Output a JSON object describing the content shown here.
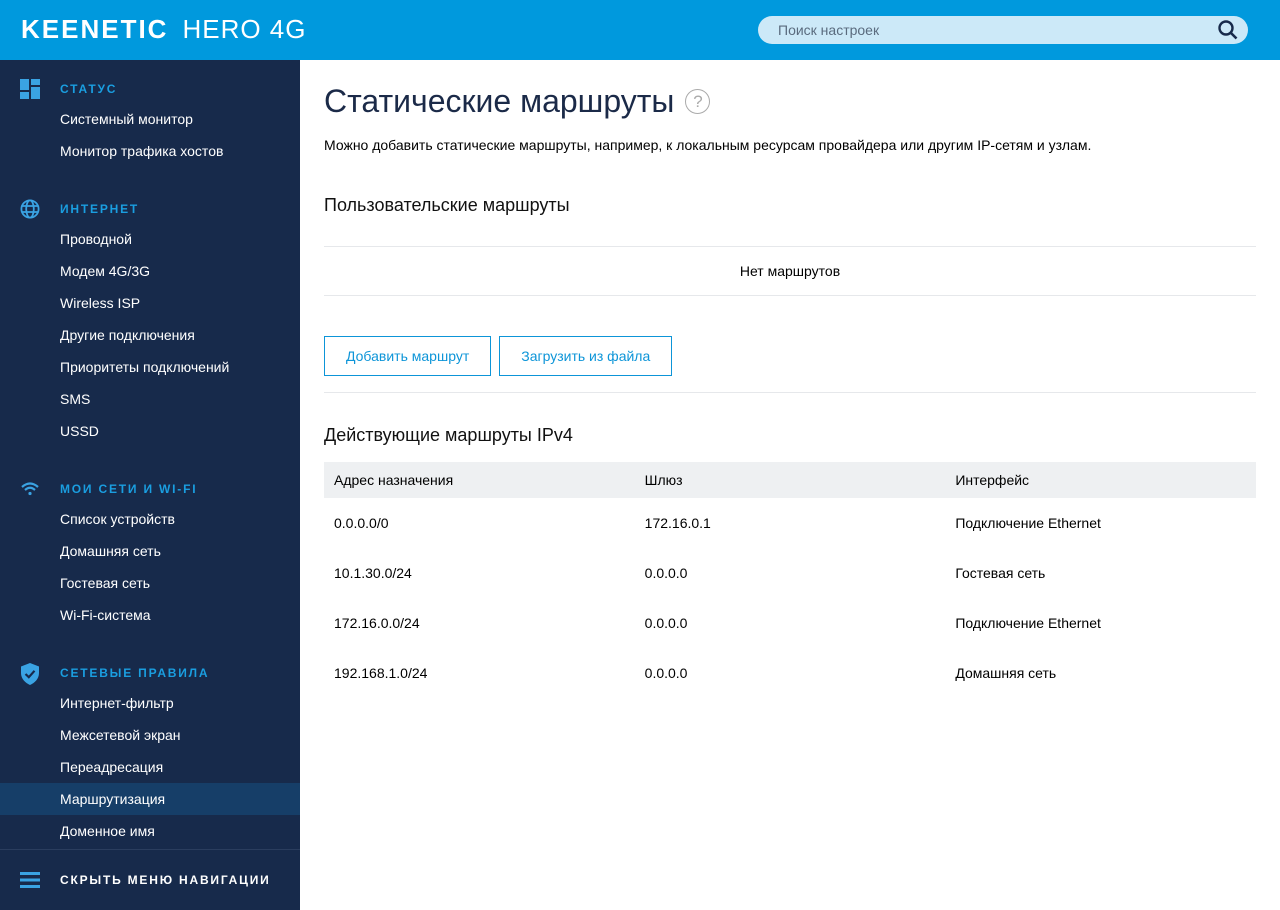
{
  "header": {
    "brand": "KEENETIC",
    "model": "HERO 4G",
    "search_placeholder": "Поиск настроек"
  },
  "colors": {
    "header": "#0099dd",
    "sidebar": "#172a4b",
    "accent": "#1a9ee0",
    "active": "#163e68"
  },
  "sidebar": {
    "sections": [
      {
        "title": "СТАТУС",
        "icon": "dashboard-icon",
        "items": [
          "Системный монитор",
          "Монитор трафика хостов"
        ]
      },
      {
        "title": "ИНТЕРНЕТ",
        "icon": "globe-icon",
        "items": [
          "Проводной",
          "Модем 4G/3G",
          "Wireless ISP",
          "Другие подключения",
          "Приоритеты подключений",
          "SMS",
          "USSD"
        ]
      },
      {
        "title": "МОИ СЕТИ И WI-FI",
        "icon": "wifi-icon",
        "items": [
          "Список устройств",
          "Домашняя сеть",
          "Гостевая сеть",
          "Wi-Fi-система"
        ]
      },
      {
        "title": "СЕТЕВЫЕ ПРАВИЛА",
        "icon": "shield-icon",
        "items": [
          "Интернет-фильтр",
          "Межсетевой экран",
          "Переадресация",
          "Маршрутизация",
          "Доменное имя"
        ]
      }
    ],
    "active_item": "Маршрутизация",
    "hide_label": "СКРЫТЬ МЕНЮ НАВИГАЦИИ"
  },
  "main": {
    "title": "Статические маршруты",
    "description": "Можно добавить статические маршруты, например, к локальным ресурсам провайдера или другим IP-сетям и узлам.",
    "user_routes": {
      "title": "Пользовательские маршруты",
      "empty": "Нет маршрутов",
      "add_button": "Добавить маршрут",
      "load_button": "Загрузить из файла"
    },
    "active_routes": {
      "title": "Действующие маршруты IPv4",
      "columns": [
        "Адрес назначения",
        "Шлюз",
        "Интерфейс"
      ],
      "rows": [
        [
          "0.0.0.0/0",
          "172.16.0.1",
          "Подключение Ethernet"
        ],
        [
          "10.1.30.0/24",
          "0.0.0.0",
          "Гостевая сеть"
        ],
        [
          "172.16.0.0/24",
          "0.0.0.0",
          "Подключение Ethernet"
        ],
        [
          "192.168.1.0/24",
          "0.0.0.0",
          "Домашняя сеть"
        ]
      ]
    }
  }
}
